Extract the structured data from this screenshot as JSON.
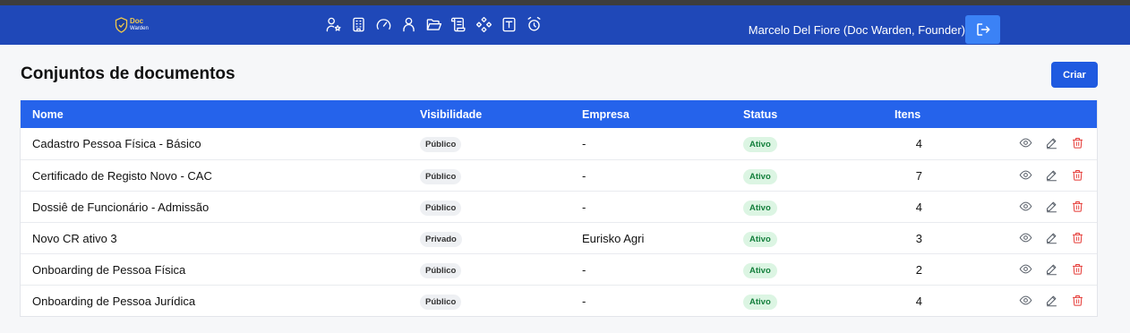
{
  "header": {
    "logo_line1": "Doc",
    "logo_line2": "Warden",
    "nav_icons": [
      "users-star-icon",
      "building-icon",
      "gauge-icon",
      "user-icon",
      "folder-open-icon",
      "scroll-icon",
      "components-icon",
      "template-icon",
      "alarm-clock-icon"
    ],
    "user_label": "Marcelo Del Fiore (Doc Warden, Founder)",
    "logout_icon": "logout-icon"
  },
  "page": {
    "title": "Conjuntos de documentos",
    "create_label": "Criar"
  },
  "table": {
    "columns": [
      "Nome",
      "Visibilidade",
      "Empresa",
      "Status",
      "Itens"
    ],
    "rows": [
      {
        "name": "Cadastro Pessoa Física - Básico",
        "visibility": "Público",
        "company": "-",
        "status": "Ativo",
        "items": "4"
      },
      {
        "name": "Certificado de Registo Novo - CAC",
        "visibility": "Público",
        "company": "-",
        "status": "Ativo",
        "items": "7"
      },
      {
        "name": "Dossiê de Funcionário - Admissão",
        "visibility": "Público",
        "company": "-",
        "status": "Ativo",
        "items": "4"
      },
      {
        "name": "Novo CR ativo 3",
        "visibility": "Privado",
        "company": "Eurisko Agri",
        "status": "Ativo",
        "items": "3"
      },
      {
        "name": "Onboarding de Pessoa Física",
        "visibility": "Público",
        "company": "-",
        "status": "Ativo",
        "items": "2"
      },
      {
        "name": "Onboarding de Pessoa Jurídica",
        "visibility": "Público",
        "company": "-",
        "status": "Ativo",
        "items": "4"
      }
    ],
    "row_action_icons": [
      "eye-icon",
      "pencil-icon",
      "trash-icon"
    ]
  },
  "colors": {
    "navbar": "#1f48b8",
    "table_header": "#2563eb",
    "primary_button": "#1f5ae0",
    "status_active_bg": "#dcf5e3",
    "status_active_text": "#15803d",
    "delete": "#e53935"
  }
}
